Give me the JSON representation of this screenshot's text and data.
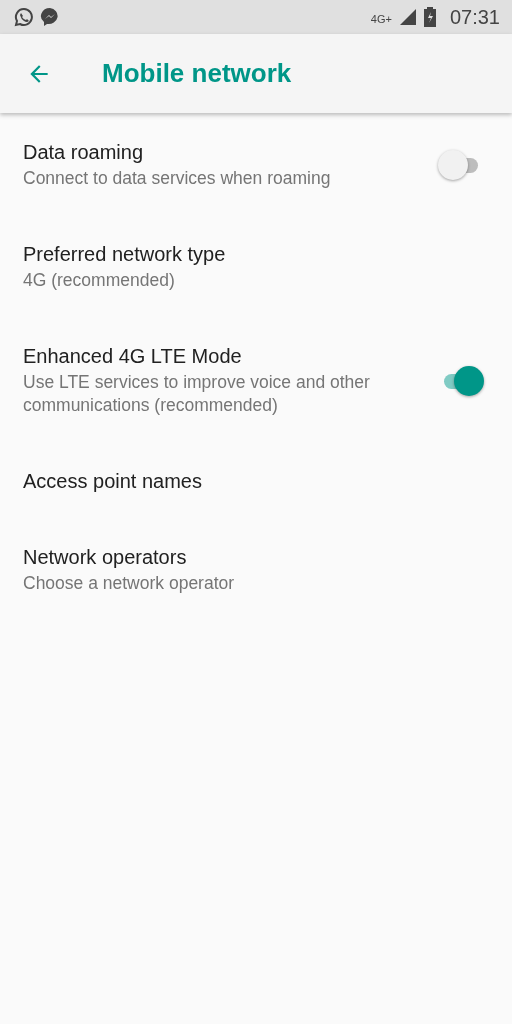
{
  "status_bar": {
    "network": "4G+",
    "time": "07:31"
  },
  "toolbar": {
    "title": "Mobile network"
  },
  "settings": [
    {
      "kind": "switch",
      "title": "Data roaming",
      "summary": "Connect to data services when roaming",
      "on": false
    },
    {
      "kind": "text",
      "title": "Preferred network type",
      "summary": "4G (recommended)"
    },
    {
      "kind": "switch",
      "title": "Enhanced 4G LTE Mode",
      "summary": "Use LTE services to improve voice and other communications (recommended)",
      "on": true
    },
    {
      "kind": "text",
      "title": "Access point names"
    },
    {
      "kind": "text",
      "title": "Network operators",
      "summary": "Choose a network operator"
    }
  ]
}
